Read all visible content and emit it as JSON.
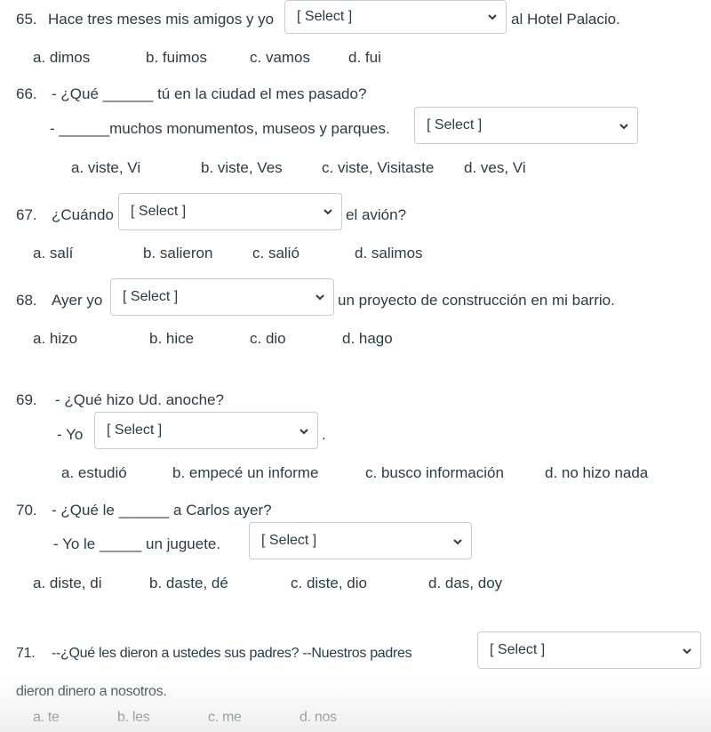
{
  "select_placeholder": "[ Select ]",
  "questions": [
    {
      "number": "65.",
      "lines": [
        "Hace tres meses mis amigos y yo",
        "al Hotel Palacio."
      ],
      "options": [
        "a.  dimos",
        "b.  fuimos",
        "c.  vamos",
        "d.  fui"
      ]
    },
    {
      "number": "66.",
      "lines": [
        "- ¿Qué ______ tú en la ciudad el mes pasado?",
        "- ______muchos monumentos, museos y parques."
      ],
      "options": [
        "a.  viste,  Vi",
        "b. viste,  Ves",
        "c.  viste,  Visitaste",
        "d.  ves,  Vi"
      ]
    },
    {
      "number": "67.",
      "lines": [
        "¿Cuándo",
        "el avión?"
      ],
      "options": [
        "a.  salí",
        "b.  salieron",
        "c.  salió",
        "d.  salimos"
      ]
    },
    {
      "number": "68.",
      "lines": [
        "Ayer yo",
        "un proyecto de construcción en mi barrio."
      ],
      "options": [
        "a.  hizo",
        "b.  hice",
        "c.  dio",
        "d.  hago"
      ]
    },
    {
      "number": "69.",
      "lines": [
        "-  ¿Qué hizo Ud. anoche?",
        "-  Yo",
        "."
      ],
      "options": [
        "a.   estudió",
        "b.  empecé un informe",
        "c. busco información",
        "d.  no hizo nada"
      ]
    },
    {
      "number": "70.",
      "lines": [
        "- ¿Qué le ______ a Carlos ayer?",
        "- Yo le _____ un juguete."
      ],
      "options": [
        "a.   diste,  di",
        "b.  daste,  dé",
        "c.  diste,  dio",
        "d.   das,  doy"
      ]
    },
    {
      "number": "71.",
      "lines": [
        "--¿Qué les dieron a ustedes sus padres?   --Nuestros padres",
        "dieron dinero a nosotros."
      ],
      "options": [
        "a.  te",
        "b.  les",
        "c.  me",
        "d.  nos"
      ]
    }
  ]
}
